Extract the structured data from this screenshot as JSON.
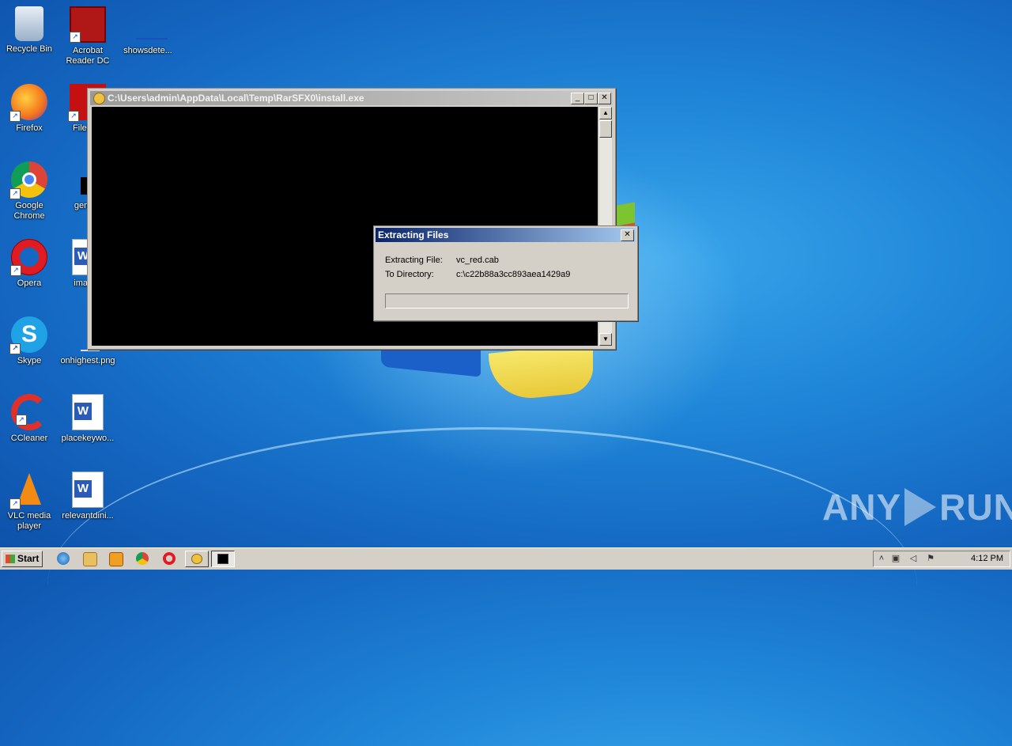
{
  "desktop": {
    "icons": [
      {
        "label": "Recycle Bin",
        "name": "recycle-bin-icon"
      },
      {
        "label": "Acrobat Reader DC",
        "name": "acrobat-reader-icon"
      },
      {
        "label": "showsdete...",
        "name": "file-icon"
      },
      {
        "label": "Firefox",
        "name": "firefox-icon"
      },
      {
        "label": "FileZilla",
        "name": "filezilla-icon"
      },
      {
        "label": "Google Chrome",
        "name": "chrome-icon"
      },
      {
        "label": "genera",
        "name": "file-icon"
      },
      {
        "label": "Opera",
        "name": "opera-icon"
      },
      {
        "label": "images",
        "name": "word-document-icon"
      },
      {
        "label": "Skype",
        "name": "skype-icon"
      },
      {
        "label": "onhighest.png",
        "name": "image-file-icon"
      },
      {
        "label": "CCleaner",
        "name": "ccleaner-icon"
      },
      {
        "label": "placekeywo...",
        "name": "word-document-icon"
      },
      {
        "label": "VLC media player",
        "name": "vlc-icon"
      },
      {
        "label": "relevantdini...",
        "name": "word-document-icon"
      }
    ]
  },
  "console": {
    "title": "C:\\Users\\admin\\AppData\\Local\\Temp\\RarSFX0\\install.exe",
    "minimize": "_",
    "maximize": "□",
    "close": "✕"
  },
  "dialog": {
    "title": "Extracting Files",
    "close": "✕",
    "file_label": "Extracting File:",
    "file_value": "vc_red.cab",
    "dir_label": "To Directory:",
    "dir_value": "c:\\c22b88a3cc893aea1429a9",
    "progress": 0
  },
  "watermark": {
    "left": "ANY",
    "right": "RUN"
  },
  "taskbar": {
    "start_label": "Start",
    "clock": "4:12 PM",
    "tray_icons": [
      "chevron-up-icon",
      "network-icon",
      "volume-icon",
      "flag-icon"
    ]
  },
  "colors": {
    "dialog_title_start": "#0a246a",
    "dialog_title_end": "#a6caf0",
    "console_title_start": "#9a9a9a"
  }
}
